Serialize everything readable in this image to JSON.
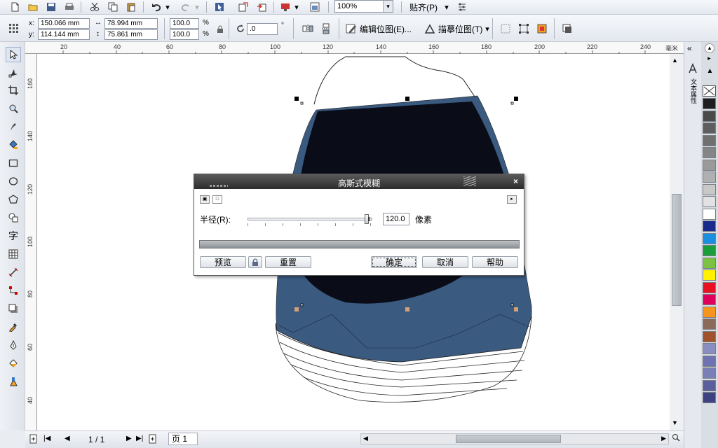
{
  "toolbar": {
    "zoom": "100%",
    "snap": "贴齐(P)"
  },
  "properties": {
    "x_label": "x:",
    "y_label": "y:",
    "x": "150.066 mm",
    "y": "114.144 mm",
    "width": "78.994 mm",
    "height": "75.861 mm",
    "scale_x": "100.0",
    "scale_y": "100.0",
    "percent": "%",
    "rotation": ".0",
    "degree": "°",
    "edit_bitmap": "编辑位图(E)...",
    "trace_bitmap": "描摹位图(T)"
  },
  "ruler": {
    "unit": "毫米",
    "h_ticks": [
      "20",
      "40",
      "60",
      "80",
      "100",
      "120",
      "140",
      "160",
      "180",
      "200",
      "220",
      "240"
    ],
    "v_ticks": [
      "160",
      "140",
      "120",
      "100",
      "80",
      "60",
      "40"
    ]
  },
  "dialog": {
    "title": "高斯式模糊",
    "radius_label": "半径(R):",
    "radius_value": "120.0",
    "radius_unit": "像素",
    "preview": "预览",
    "reset": "重置",
    "ok": "确定",
    "cancel": "取消",
    "help": "帮助"
  },
  "statusbar": {
    "page_counter": "1 / 1",
    "page_tab": "页 1"
  },
  "dock": {
    "object_props": "文本属性"
  },
  "palette": [
    "#1e1e1e",
    "#4a4a4a",
    "#5e5e5e",
    "#707070",
    "#858585",
    "#9a9a9a",
    "#b0b0b0",
    "#c8c8c8",
    "#e2e2e2",
    "#ffffff",
    "#1a2a8c",
    "#1a8fe0",
    "#1a9e3a",
    "#7cc242",
    "#fff100",
    "#e81123",
    "#e0005a",
    "#f7941d",
    "#8b6a5a",
    "#a0522d",
    "#8a8dc0",
    "#6e72b0",
    "#7a7fb8",
    "#5a5e9a",
    "#3e4280"
  ],
  "colors": {
    "shape_blue": "#3a5a80",
    "shape_dark": "#0a0d18"
  }
}
